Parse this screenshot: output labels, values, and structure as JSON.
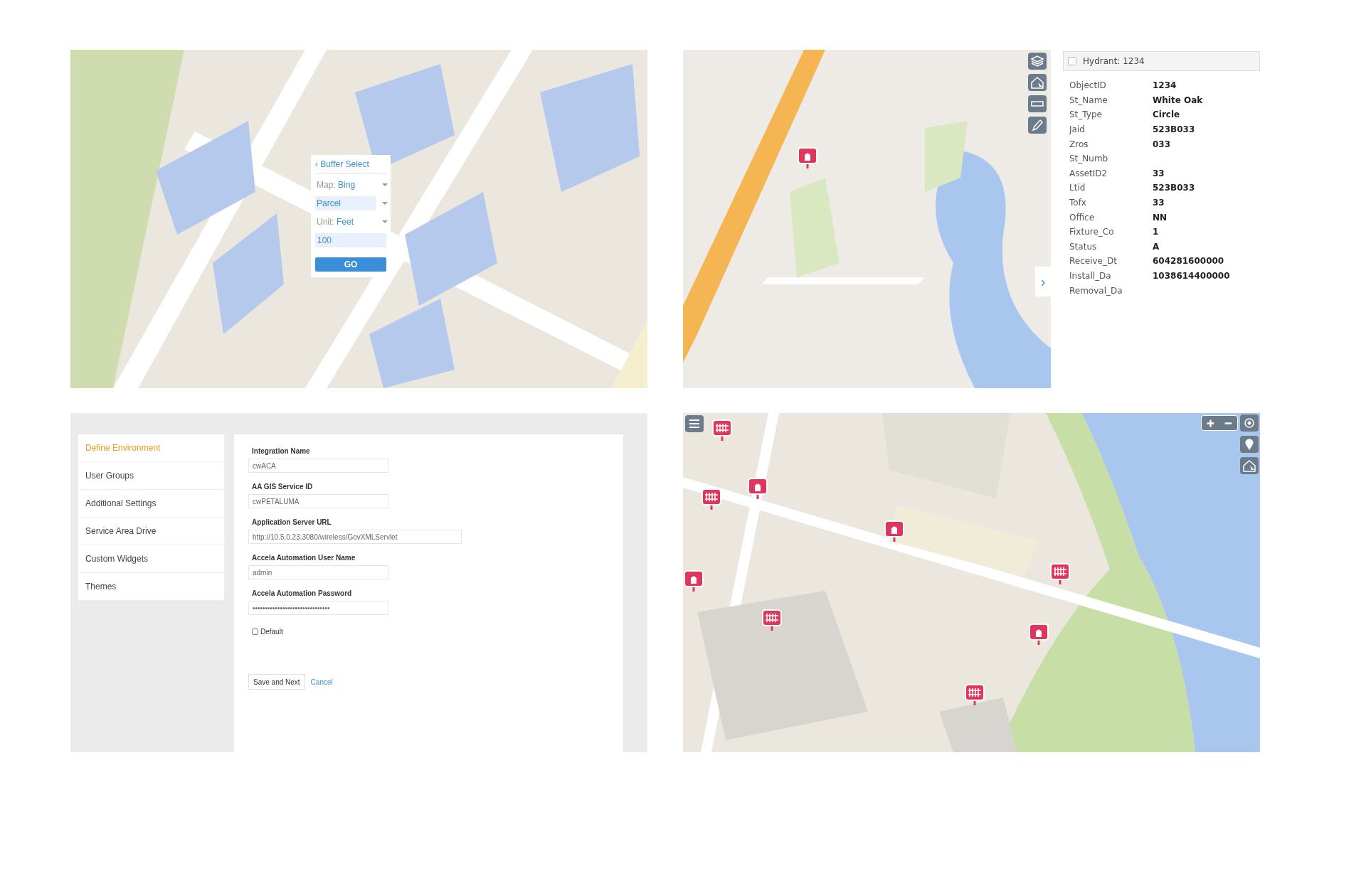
{
  "parcel_map": {
    "buffer_select": {
      "back": "‹",
      "title": "Buffer Select",
      "map_label": "Map:",
      "map_value": "Bing",
      "layer": "Parcel",
      "unit_label": "Unit:",
      "unit_value": "Feet",
      "distance": "100",
      "go": "GO"
    }
  },
  "hydrant_map": {
    "expand": "›"
  },
  "feature_panel": {
    "checked": false,
    "title": "Hydrant: 1234",
    "attributes": [
      {
        "name": "ObjectID",
        "value": "1234"
      },
      {
        "name": "St_Name",
        "value": "White Oak"
      },
      {
        "name": "St_Type",
        "value": "Circle"
      },
      {
        "name": "Jaid",
        "value": "523B033"
      },
      {
        "name": "Zros",
        "value": "033"
      },
      {
        "name": "St_Numb"
      },
      {
        "name": "AssetID2",
        "value": "33"
      },
      {
        "name": "Ltid",
        "value": "523B033"
      },
      {
        "name": "Tofx",
        "value": "33"
      },
      {
        "name": "Office",
        "value": "NN"
      },
      {
        "name": "Fixture_Co",
        "value": "1"
      },
      {
        "name": "Status",
        "value": "A"
      },
      {
        "name": "Receive_Dt",
        "value": "604281600000"
      },
      {
        "name": "Install_Da",
        "value": "1038614400000"
      },
      {
        "name": "Removal_Da"
      }
    ]
  },
  "settings": {
    "nav": [
      {
        "label": "Define Environment",
        "selected": true
      },
      {
        "label": "User Groups",
        "selected": false
      },
      {
        "label": "Additional Settings",
        "selected": false
      },
      {
        "label": "Service Area Drive",
        "selected": false
      },
      {
        "label": "Custom Widgets",
        "selected": false
      },
      {
        "label": "Themes",
        "selected": false
      }
    ],
    "fields": [
      {
        "label": "Integration Name",
        "value": "cwACA",
        "wide": false
      },
      {
        "label": "AA GIS Service ID",
        "value": "cwPETALUMA",
        "wide": false
      },
      {
        "label": "Application Server URL",
        "value": "http://10.5.0.23.3080/wireless/GovXMLServlet",
        "wide": true
      },
      {
        "label": "Accela Automation User Name",
        "value": "admin",
        "wide": false
      },
      {
        "label": "Accela Automation Password",
        "value": "•••••••••••••••••••••••••••••••",
        "wide": false
      }
    ],
    "default_checkbox": {
      "label": "Default",
      "checked": false
    },
    "buttons": {
      "save": "Save and Next",
      "cancel": "Cancel"
    }
  }
}
